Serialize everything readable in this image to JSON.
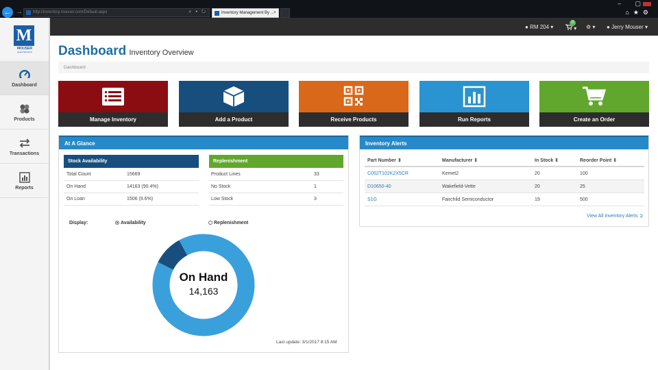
{
  "browser": {
    "url": "http://inventory.mouser.com/Default.aspx",
    "tab_title": "Inventory Management By ...",
    "back": "←",
    "forward": "→",
    "address_controls": "⌕ ▾ ↻",
    "tab_close": "×",
    "window_controls": "– ▢",
    "toolbar_icons": "⌂★⚙"
  },
  "header": {
    "location": "RM 204",
    "cart_count": "0",
    "user": "Jerry Mouser"
  },
  "logo": {
    "text": "MOUSER",
    "sub": "ELECTRONICS",
    "mark": "M"
  },
  "sidebar": {
    "items": [
      {
        "label": "Dashboard",
        "icon": "speedometer-icon"
      },
      {
        "label": "Products",
        "icon": "components-icon"
      },
      {
        "label": "Transactions",
        "icon": "transfer-arrows-icon"
      },
      {
        "label": "Reports",
        "icon": "bar-chart-icon"
      }
    ]
  },
  "page": {
    "title": "Dashboard",
    "subtitle": "Inventory Overview",
    "breadcrumb": "Dashboard"
  },
  "tiles": [
    {
      "label": "Manage Inventory",
      "color": "#8b0d12",
      "icon": "list-icon"
    },
    {
      "label": "Add a Product",
      "color": "#174e7e",
      "icon": "cube-icon"
    },
    {
      "label": "Receive Products",
      "color": "#d9681b",
      "icon": "qr-code-icon"
    },
    {
      "label": "Run Reports",
      "color": "#2a93d1",
      "icon": "bar-chart-icon"
    },
    {
      "label": "Create an Order",
      "color": "#61a72d",
      "icon": "cart-icon"
    }
  ],
  "glance": {
    "title": "At A Glance",
    "stock": {
      "heading": "Stock Availability",
      "color": "#174e7e",
      "rows": [
        {
          "label": "Total Count",
          "value": "15669"
        },
        {
          "label": "On Hand",
          "value": "14163 (90.4%)"
        },
        {
          "label": "On Loan",
          "value": "1506 (9.6%)"
        }
      ]
    },
    "replenishment": {
      "heading": "Replenishment",
      "color": "#61a72d",
      "rows": [
        {
          "label": "Product Lines",
          "value": "33"
        },
        {
          "label": "No Stock",
          "value": "1"
        },
        {
          "label": "Low Stock",
          "value": "3"
        }
      ]
    },
    "display_label": "Display:",
    "options": [
      "Availability",
      "Replenishment"
    ],
    "selected_option": "Availability",
    "donut": {
      "center_title": "On Hand",
      "center_value": "14,163",
      "on_hand_fraction": 0.904,
      "on_loan_fraction": 0.096,
      "on_hand_color": "#3aa0dc",
      "on_loan_color": "#174e7e"
    },
    "last_update_label": "Last update:",
    "last_update": "3/1/2017 8:15 AM"
  },
  "alerts": {
    "title": "Inventory Alerts",
    "columns": [
      "Part Number ⇕",
      "Manufacturer ⇕",
      "In Stock ⇕",
      "Reorder Point ⇕"
    ],
    "rows": [
      {
        "part": "C052T102K2X5CR",
        "manufacturer": "Kemet2",
        "in_stock": "20",
        "reorder": "100"
      },
      {
        "part": "D10650-40",
        "manufacturer": "Wakefield-Vette",
        "in_stock": "20",
        "reorder": "25"
      },
      {
        "part": "S1G",
        "manufacturer": "Fairchild Semiconductor",
        "in_stock": "19",
        "reorder": "500"
      }
    ],
    "view_all": "View All Inventory Alerts"
  }
}
